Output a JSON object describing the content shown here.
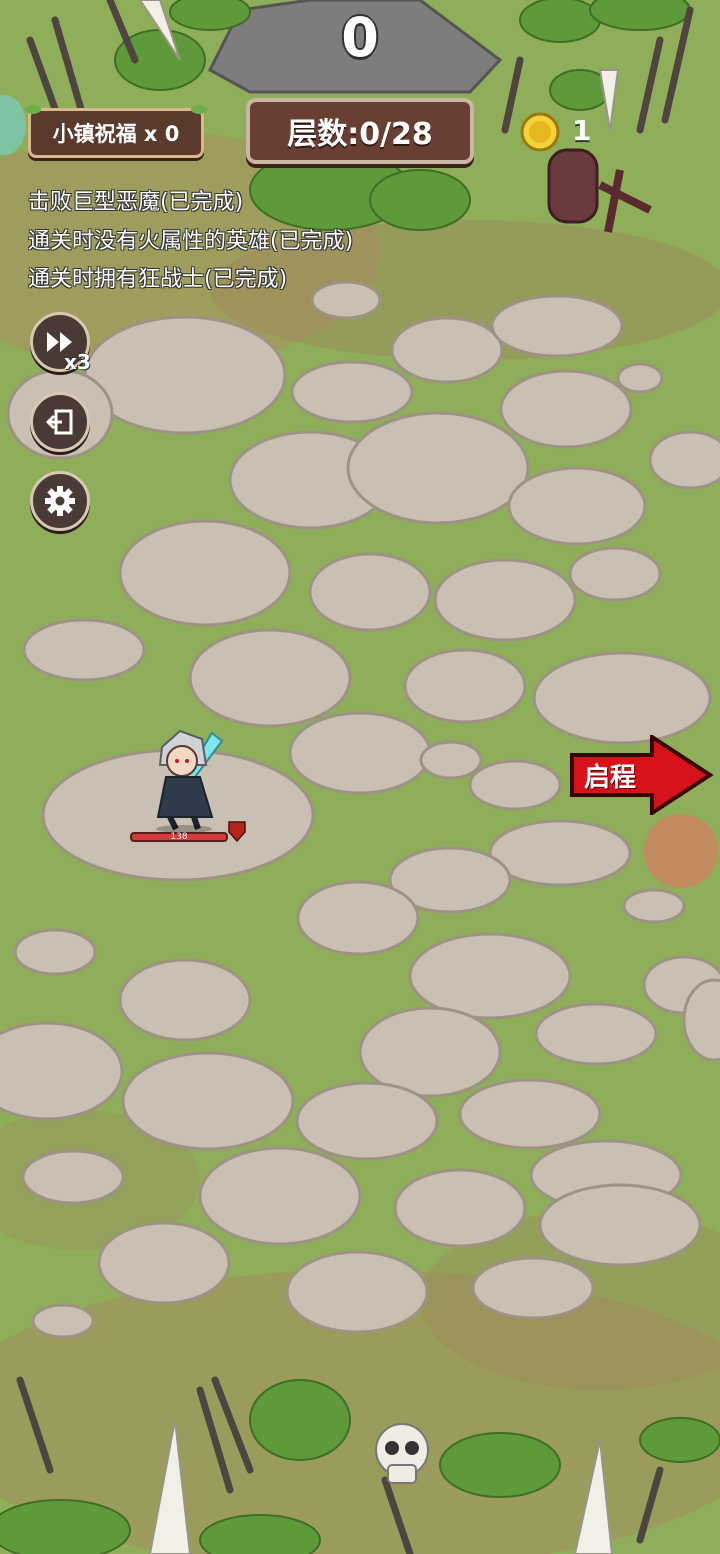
{
  "hud": {
    "score": "0",
    "blessing_label": "小镇祝福 x 0",
    "level_text": "层数:0/28",
    "coins": "1",
    "speed_multiplier": "x3",
    "depart_label": "启程",
    "hero_hp": "138"
  },
  "quests": [
    "击败巨型恶魔(已完成)",
    "通关时没有火属性的英雄(已完成)",
    "通关时拥有狂战士(已完成)"
  ],
  "icons": {
    "speed": "fast-forward-icon",
    "exit": "exit-icon",
    "settings": "gear-icon",
    "coin": "coin-icon",
    "depart": "right-arrow-icon",
    "skull": "skull-icon"
  },
  "colors": {
    "grass": "#8fae5a",
    "stone": "#c9c0b3",
    "stone_border": "#9d9283",
    "panel_brown": "#6a3f33",
    "arrow_red": "#d8121a"
  }
}
